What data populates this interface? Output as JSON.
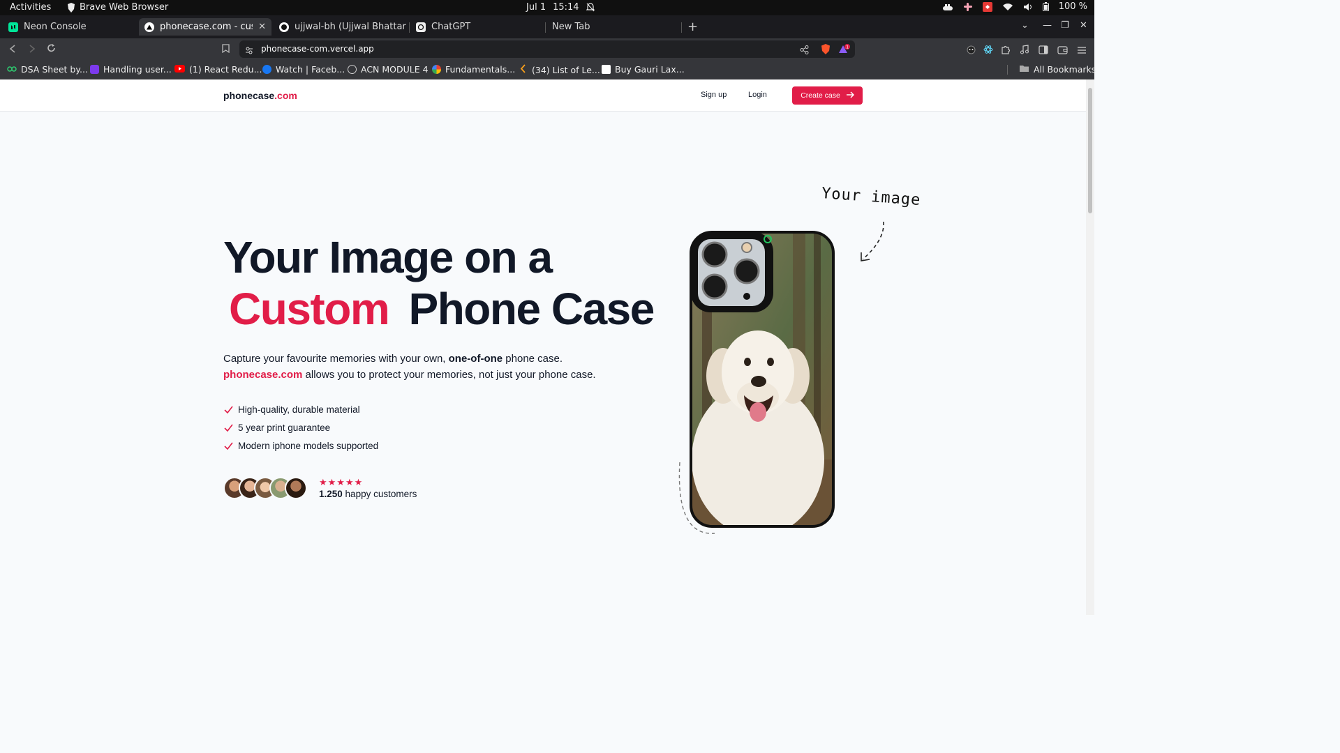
{
  "os": {
    "activities": "Activities",
    "app_name": "Brave Web Browser",
    "date": "Jul 1",
    "time": "15:14",
    "battery": "100 %"
  },
  "tabs": [
    {
      "label": "Neon Console",
      "active": false
    },
    {
      "label": "phonecase.com - custom",
      "active": true
    },
    {
      "label": "ujjwal-bh (Ujjwal Bhattarai)",
      "active": false
    },
    {
      "label": "ChatGPT",
      "active": false
    },
    {
      "label": "New Tab",
      "active": false
    }
  ],
  "address_bar": {
    "url": "phonecase-com.vercel.app"
  },
  "bookmarks": [
    {
      "label": "DSA Sheet by...",
      "icon": "dsa-icon"
    },
    {
      "label": "Handling user...",
      "icon": "rocket-icon"
    },
    {
      "label": "(1) React Redu...",
      "icon": "youtube-icon"
    },
    {
      "label": "Watch | Faceb...",
      "icon": "facebook-icon"
    },
    {
      "label": "ACN MODULE 4",
      "icon": "globe-icon"
    },
    {
      "label": "Fundamentals...",
      "icon": "google-icon"
    },
    {
      "label": "(34) List of Le...",
      "icon": "leetcode-icon"
    },
    {
      "label": "Buy Gauri Lax...",
      "icon": "amazon-icon"
    }
  ],
  "all_bookmarks": "All Bookmarks",
  "site": {
    "brand_main": "phonecase",
    "brand_accent": ".com",
    "nav": {
      "signup": "Sign up",
      "login": "Login",
      "cta": "Create case"
    },
    "headline": {
      "line1": "Your Image on a",
      "highlight": "Custom",
      "line2_rest": "Phone Case"
    },
    "description": {
      "part1": "Capture your favourite memories with your own, ",
      "bold": "one-of-one",
      "part2": " phone case.",
      "brand": "phonecase.com",
      "part3": " allows you to protect your memories, not just your phone case."
    },
    "features": [
      "High-quality, durable material",
      "5 year print guarantee",
      "Modern iphone models supported"
    ],
    "social_proof": {
      "stars": "★★★★★",
      "count": "1.250",
      "label": " happy customers"
    },
    "annotation": "Your image"
  },
  "colors": {
    "accent": "#e11d48",
    "text": "#111827",
    "page_bg": "#f8fafc"
  }
}
